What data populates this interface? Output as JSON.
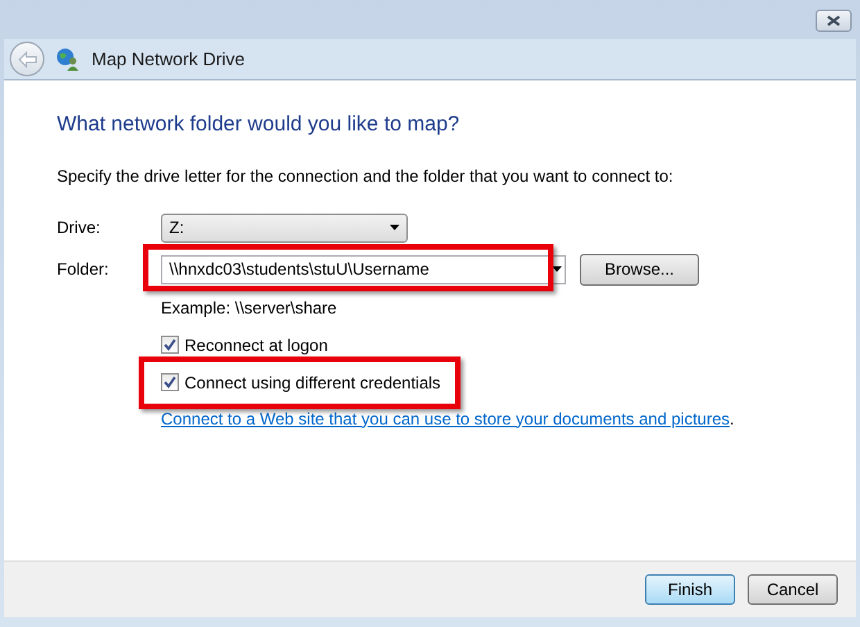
{
  "window": {
    "title": "Map Network Drive"
  },
  "heading": "What network folder would you like to map?",
  "instruction": "Specify the drive letter for the connection and the folder that you want to connect to:",
  "drive": {
    "label": "Drive:",
    "value": "Z:"
  },
  "folder": {
    "label": "Folder:",
    "value": "\\\\hnxdc03\\students\\stuU\\Username",
    "highlighted": true
  },
  "browse_button": "Browse...",
  "example": "Example: \\\\server\\share",
  "options": [
    {
      "label": "Reconnect at logon",
      "checked": true,
      "highlighted": false
    },
    {
      "label": "Connect using different credentials",
      "checked": true,
      "highlighted": true
    }
  ],
  "link": {
    "text": "Connect to a Web site that you can use to store your documents and pictures",
    "suffix": "."
  },
  "buttons": [
    {
      "label": "Finish",
      "default": true
    },
    {
      "label": "Cancel",
      "default": false
    }
  ]
}
